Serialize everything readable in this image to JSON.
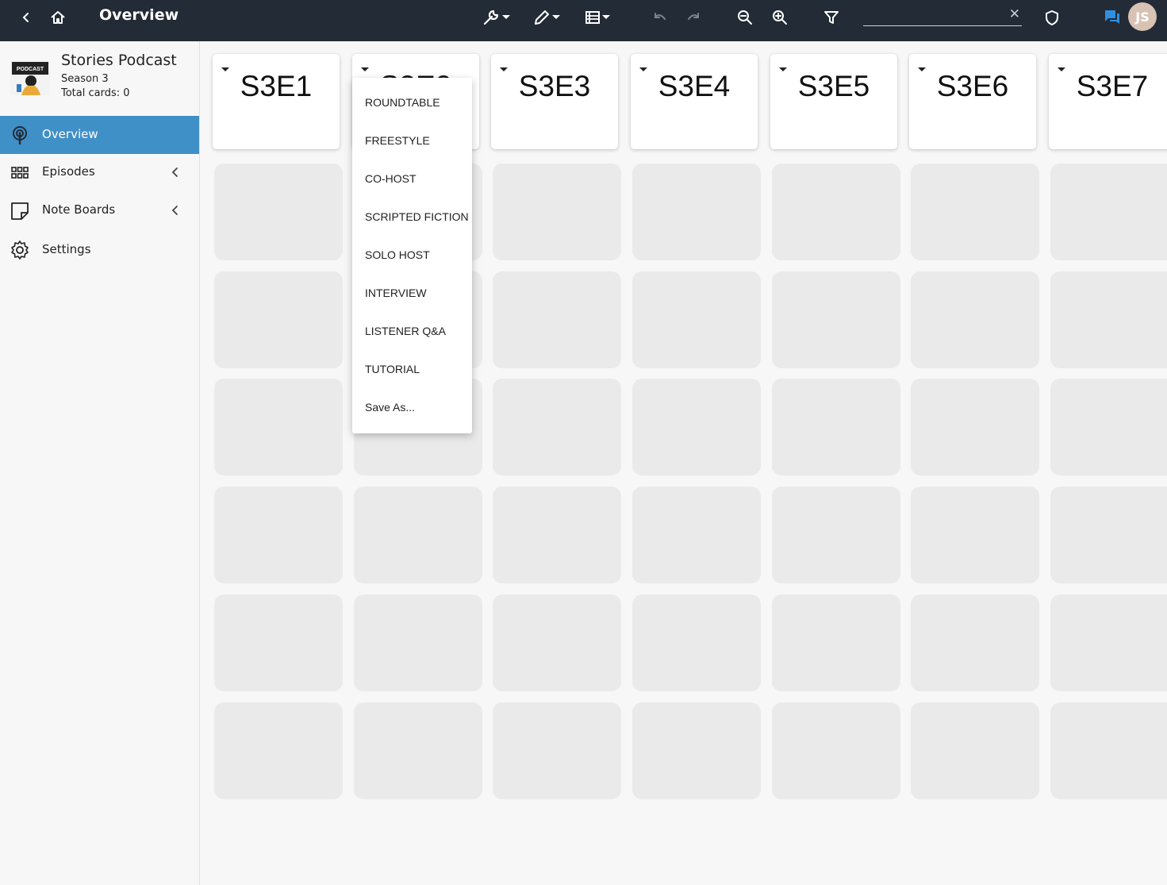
{
  "header": {
    "title": "Overview",
    "search": {
      "value": "",
      "placeholder": ""
    },
    "clear_symbol": "✕",
    "avatar_initials": "JS"
  },
  "colors": {
    "topbar": "#222b36",
    "active_nav": "#4090c8",
    "chat_icon": "#2f8fe0",
    "cell": "#eaeaea"
  },
  "sidebar": {
    "project": {
      "name": "Stories Podcast",
      "season": "Season 3",
      "total_cards": "Total cards: 0",
      "logo_text": "PODCAST"
    },
    "items": [
      {
        "label": "Overview",
        "icon": "podcast-icon",
        "active": true
      },
      {
        "label": "Episodes",
        "icon": "grid-icon",
        "expandable": true
      },
      {
        "label": "Note Boards",
        "icon": "note-icon",
        "expandable": true
      },
      {
        "label": "Settings",
        "icon": "gear-icon"
      }
    ]
  },
  "board": {
    "columns": [
      {
        "title": "S3E1"
      },
      {
        "title": "S3E2"
      },
      {
        "title": "S3E3"
      },
      {
        "title": "S3E4"
      },
      {
        "title": "S3E5"
      },
      {
        "title": "S3E6"
      },
      {
        "title": "S3E7"
      }
    ],
    "rows": 6
  },
  "dropdown": {
    "items": [
      "ROUNDTABLE",
      "FREESTYLE",
      "CO-HOST",
      "SCRIPTED FICTION",
      "SOLO HOST",
      "INTERVIEW",
      "LISTENER Q&A",
      "TUTORIAL",
      "Save As..."
    ]
  }
}
